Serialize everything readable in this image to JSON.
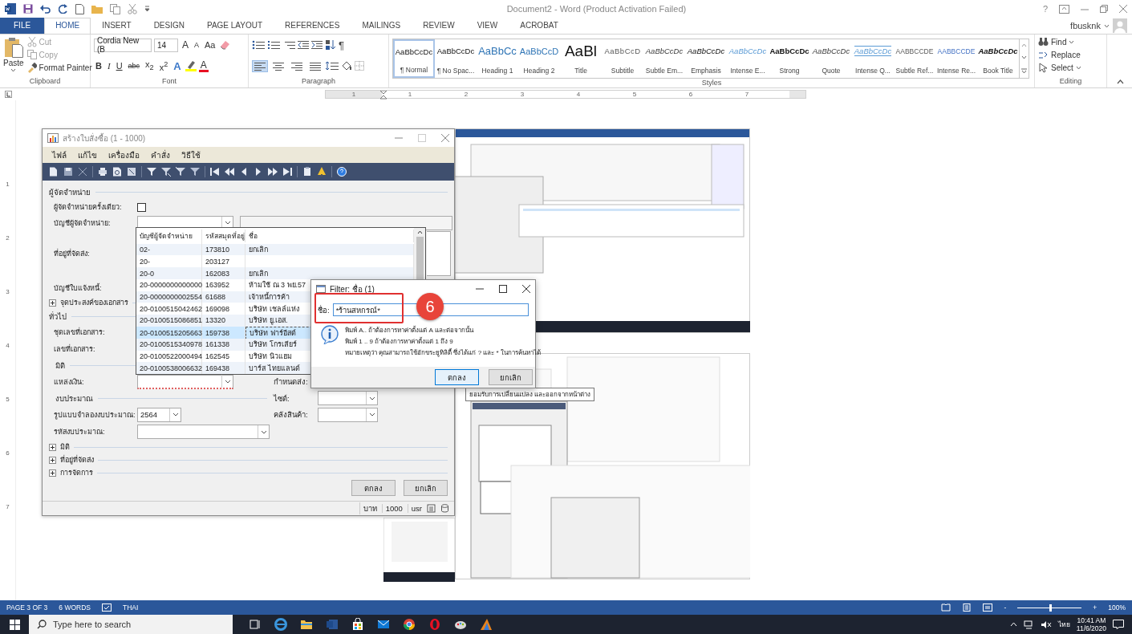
{
  "window": {
    "title": "Document2 - Word (Product Activation Failed)",
    "help": "?",
    "user": "fbusknk"
  },
  "ribbon_tabs": [
    {
      "label": "FILE",
      "kind": "file",
      "selected": false
    },
    {
      "label": "HOME",
      "kind": "tab",
      "selected": true
    },
    {
      "label": "INSERT",
      "kind": "tab",
      "selected": false
    },
    {
      "label": "DESIGN",
      "kind": "tab",
      "selected": false
    },
    {
      "label": "PAGE LAYOUT",
      "kind": "tab",
      "selected": false
    },
    {
      "label": "REFERENCES",
      "kind": "tab",
      "selected": false
    },
    {
      "label": "MAILINGS",
      "kind": "tab",
      "selected": false
    },
    {
      "label": "REVIEW",
      "kind": "tab",
      "selected": false
    },
    {
      "label": "VIEW",
      "kind": "tab",
      "selected": false
    },
    {
      "label": "ACROBAT",
      "kind": "tab",
      "selected": false
    }
  ],
  "clipboard": {
    "label": "Clipboard",
    "paste": "Paste",
    "commands": [
      {
        "label": "Cut",
        "disabled": true
      },
      {
        "label": "Copy",
        "disabled": true
      },
      {
        "label": "Format Painter",
        "disabled": false
      }
    ]
  },
  "font": {
    "label": "Font",
    "name": "Cordia New (B",
    "size": "14",
    "tools": [
      {
        "kind": "grow",
        "glyph": "A"
      },
      {
        "kind": "shrink",
        "glyph": "A"
      },
      {
        "kind": "case",
        "glyph": "Aa"
      }
    ],
    "formats": [
      {
        "kind": "bold",
        "glyph": "B"
      },
      {
        "kind": "italic",
        "glyph": "I"
      },
      {
        "kind": "underline",
        "glyph": "U"
      },
      {
        "kind": "strike",
        "glyph": "abc"
      },
      {
        "kind": "subscript",
        "glyph": "x$_{2}$"
      },
      {
        "kind": "superscript",
        "glyph": "x$^{2}$"
      }
    ],
    "effects": "A",
    "font_color": "A"
  },
  "paragraph": {
    "label": "Paragraph",
    "show_marks": "¶",
    "alignments": [
      {
        "kind": "left",
        "selected": true
      },
      {
        "kind": "center",
        "selected": false
      },
      {
        "kind": "right",
        "selected": false
      },
      {
        "kind": "justify",
        "selected": false
      }
    ]
  },
  "styles": {
    "label": "Styles",
    "items": [
      {
        "preview": "AaBbCcDc",
        "name": "¶ Normal",
        "kind": "normal",
        "selected": true
      },
      {
        "preview": "AaBbCcDc",
        "name": "¶ No Spac...",
        "kind": "normal",
        "selected": false
      },
      {
        "preview": "AaBbCc",
        "name": "Heading 1",
        "kind": "heading1",
        "selected": false
      },
      {
        "preview": "AaBbCcD",
        "name": "Heading 2",
        "kind": "heading2",
        "selected": false
      },
      {
        "preview": "AaBl",
        "name": "Title",
        "kind": "title",
        "selected": false
      },
      {
        "preview": "AaBbCcD",
        "name": "Subtitle",
        "kind": "subtitle",
        "selected": false
      },
      {
        "preview": "AaBbCcDc",
        "name": "Subtle Em...",
        "kind": "subtle-emphasis",
        "selected": false
      },
      {
        "preview": "AaBbCcDc",
        "name": "Emphasis",
        "kind": "emphasis",
        "selected": false
      },
      {
        "preview": "AaBbCcDc",
        "name": "Intense E...",
        "kind": "intense-emphasis",
        "selected": false
      },
      {
        "preview": "AaBbCcDc",
        "name": "Strong",
        "kind": "strong",
        "selected": false
      },
      {
        "preview": "AaBbCcDc",
        "name": "Quote",
        "kind": "quote",
        "selected": false
      },
      {
        "preview": "AaBbCcDc",
        "name": "Intense Q...",
        "kind": "intense-quote",
        "selected": false
      },
      {
        "preview": "AABBCCDE",
        "name": "Subtle Ref...",
        "kind": "subtle-reference",
        "selected": false
      },
      {
        "preview": "AABBCCDE",
        "name": "Intense Re...",
        "kind": "intense-reference",
        "selected": false
      },
      {
        "preview": "AaBbCcDc",
        "name": "Book Title",
        "kind": "book-title",
        "selected": false
      }
    ]
  },
  "editing": {
    "label": "Editing",
    "items": [
      {
        "kind": "find",
        "label": "Find"
      },
      {
        "kind": "replace",
        "label": "Replace"
      },
      {
        "kind": "select",
        "label": "Select"
      }
    ]
  },
  "ruler": {
    "marks": [
      "1",
      "1",
      "2",
      "3",
      "4",
      "5",
      "6",
      "7"
    ]
  },
  "vertical_ruler": {
    "marks": [
      "1",
      "2",
      "3",
      "4",
      "5",
      "6",
      "7"
    ]
  },
  "document": {
    "order_dialog": {
      "title": "สร้างใบสั่งซื้อ (1 - 1000)",
      "menu": [
        "ไฟล์",
        "แก้ไข",
        "เครื่องมือ",
        "คำสั่ง",
        "วิธีใช้"
      ],
      "form": [
        {
          "kind": "section",
          "label": "ผู้จัดจำหน่าย"
        },
        {
          "kind": "checkbox",
          "label": "ผู้จัดจำหน่ายครั้งเดียว:",
          "checked": false
        },
        {
          "kind": "combo_name",
          "label": "บัญชีผู้จัดจำหน่าย:",
          "required": true
        },
        {
          "kind": "address",
          "label": "ที่อยู่ที่จัดส่ง:"
        },
        {
          "kind": "label",
          "label": "บัญชีใบแจ้งหนี้:"
        },
        {
          "kind": "expander",
          "label": "จุดประสงค์ของเอกสาร",
          "expanded": false
        },
        {
          "kind": "section",
          "label": "ทั่วไป"
        },
        {
          "kind": "label",
          "label": "ชุดเลขที่เอกสาร:"
        },
        {
          "kind": "label",
          "label": "เลขที่เอกสาร:"
        },
        {
          "kind": "subsection",
          "label": "มิติ"
        },
        {
          "kind": "combo",
          "label": "แหล่งเงิน:",
          "required": true,
          "right": {
            "label": "กำหนดส่ง:",
            "kind": "label"
          }
        },
        {
          "kind": "subsection",
          "label": "งบประมาณ",
          "right": {
            "label": "ไซต์:",
            "kind": "combo"
          }
        },
        {
          "kind": "combo_short",
          "label": "รูปแบบจำลองงบประมาณ:",
          "value": "2564",
          "required": false,
          "right": {
            "label": "คลังสินค้า:",
            "kind": "combo"
          }
        },
        {
          "kind": "combo_long",
          "label": "รหัสงบประมาณ:",
          "required": false
        },
        {
          "kind": "expander",
          "label": "มิติ",
          "expanded": false
        },
        {
          "kind": "expander",
          "label": "ที่อยู่ที่จัดส่ง",
          "expanded": false
        },
        {
          "kind": "expander",
          "label": "การจัดการ",
          "expanded": false
        }
      ],
      "lookup": {
        "columns": [
          "บัญชีผู้จัดจำหน่าย",
          "รหัสสมุดที่อยู่",
          "ชื่อ"
        ],
        "rows": [
          {
            "cells": [
              "02-",
              "173810",
              "ยกเลิก"
            ],
            "selected": false
          },
          {
            "cells": [
              "20-",
              "203127"
            ],
            "selected": false
          },
          {
            "cells": [
              "20-0",
              "162083",
              "ยกเลิก"
            ],
            "selected": false
          },
          {
            "cells": [
              "20-0000000000000",
              "163952",
              "ห้ามใช้ ณ 3 พย.57"
            ],
            "selected": false
          },
          {
            "cells": [
              "20-0000000002554",
              "61688",
              "เจ้าหนี้การค้า"
            ],
            "selected": false
          },
          {
            "cells": [
              "20-0100515042462",
              "169098",
              "บริษัท เชลล์แห่ง"
            ],
            "selected": false
          },
          {
            "cells": [
              "20-0100515086851",
              "13320",
              "บริษัท ยู.เอส."
            ],
            "selected": false
          },
          {
            "cells": [
              "20-0100515205663",
              "159738",
              "บริษัท ฟาร์อีสต์"
            ],
            "selected": true
          },
          {
            "cells": [
              "20-0100515340978",
              "161338",
              "บริษัท โกรเลียร์"
            ],
            "selected": false
          },
          {
            "cells": [
              "20-0100522000494",
              "162545",
              "บริษัท นิวแฮม"
            ],
            "selected": false
          },
          {
            "cells": [
              "20-0100538006632",
              "169438",
              "บาร์ส ไทยแลนด์"
            ],
            "selected": false
          }
        ]
      },
      "buttons": [
        "ตกลง",
        "ยกเลิก"
      ],
      "status": [
        "บาท",
        "1000",
        "usr"
      ]
    },
    "filter_dialog": {
      "title": "Filter: ชื่อ (1)",
      "field_label": "ชื่อ:",
      "value": "*ร้านสหกรณ์*",
      "hints": [
        "พิมพ์ A.. ถ้าต้องการหาค่าตั้งแต่ A และต่อจากนั้น",
        "พิมพ์ 1 .. 9 ถ้าต้องการหาค่าตั้งแต่ 1 ถึง 9",
        "หมายเหตุว่า คุณสามารถใช้อักขระยูทิลิตี้ ซึ่งได้แก่ ? และ * ในการค้นหาได้"
      ],
      "buttons": [
        {
          "label": "ตกลง",
          "default": true
        },
        {
          "label": "ยกเลิก",
          "default": false
        }
      ]
    },
    "callout": "6",
    "tooltip": "ยอมรับการเปลี่ยนแปลง และออกจากหน้าต่าง"
  },
  "status_bar": {
    "page": "PAGE 3 OF 3",
    "words": "6 WORDS",
    "language": "THAI",
    "zoom_out": "-",
    "zoom_in": "+",
    "zoom": "100%",
    "zoom_slider": {
      "level": 0.5
    }
  },
  "taskbar": {
    "search_placeholder": "Type here to search",
    "input_language": "ไทย",
    "time": "10:41 AM",
    "date": "11/6/2020"
  }
}
